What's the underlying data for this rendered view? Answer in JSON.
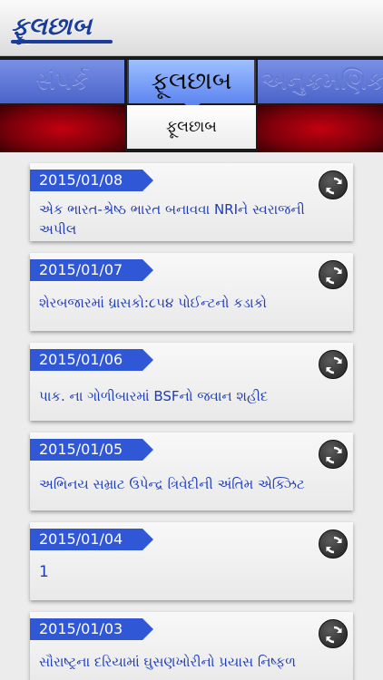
{
  "header": {
    "logo_text": "ફૂલછાબ"
  },
  "tabs": {
    "left": "સંપર્ક",
    "center": "ફૂલછાબ",
    "right": "અનુક્રમણિકા"
  },
  "subtab": "ફૂલછાબ",
  "articles": [
    {
      "date": "2015/01/08",
      "headline": "એક ભારત-શ્રેષ્ઠ ભારત બનાવવા NRIને સ્વરાજની અપીલ"
    },
    {
      "date": "2015/01/07",
      "headline": "શેરબજારમાં ધ્રાસકો:૮૫૪ પોઈન્ટનો કડાકો"
    },
    {
      "date": "2015/01/06",
      "headline": "પાક. ના ગોળીબારમાં BSFનો જવાન શહીદ"
    },
    {
      "date": "2015/01/05",
      "headline": "અભિનય સમ્રાટ ઉપેન્દ્ર ત્રિવેદીની અંતિમ એક્ઝિટ"
    },
    {
      "date": "2015/01/04",
      "headline": "1"
    },
    {
      "date": "2015/01/03",
      "headline": "સૌરાષ્ટ્રના દરિયામાં ઘુસણખોરીનો પ્રયાસ નિષ્ફળ"
    }
  ],
  "colors": {
    "brand_blue": "#1b3d9a",
    "tab_blue": "#5e86f0",
    "date_blue": "#2f57d6",
    "headline_blue": "#1e3cb8",
    "band_red": "#c40010"
  }
}
